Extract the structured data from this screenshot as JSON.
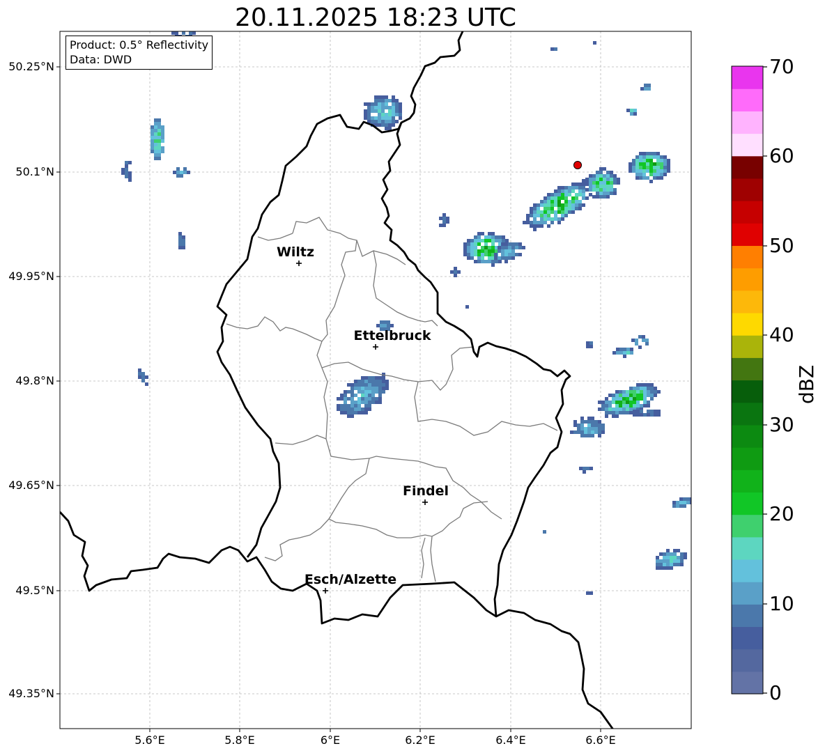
{
  "title": "20.11.2025 18:23 UTC",
  "info": {
    "product": "Product: 0.5° Reflectivity",
    "data": "Data: DWD"
  },
  "lat_ticks": [
    "50.25°N",
    "50.1°N",
    "49.95°N",
    "49.8°N",
    "49.65°N",
    "49.5°N",
    "49.35°N"
  ],
  "lon_ticks": [
    "5.6°E",
    "5.8°E",
    "6°E",
    "6.2°E",
    "6.4°E",
    "6.6°E"
  ],
  "cities": [
    {
      "name": "Wiltz"
    },
    {
      "name": "Ettelbruck"
    },
    {
      "name": "Findel"
    },
    {
      "name": "Esch/Alzette"
    }
  ],
  "colorbar": {
    "label": "dBZ",
    "ticks": [
      "0",
      "10",
      "20",
      "30",
      "40",
      "50",
      "60",
      "70"
    ],
    "colors": [
      "#6373a6",
      "#54689f",
      "#465e9e",
      "#4b78ab",
      "#5aa0c8",
      "#63c1dc",
      "#5dd6c0",
      "#3fd06e",
      "#11c626",
      "#11b21a",
      "#0f9b12",
      "#0c8a11",
      "#0a7510",
      "#075e0b",
      "#437611",
      "#aab40a",
      "#fed900",
      "#fdb80a",
      "#fe9d00",
      "#ff7f01",
      "#e00101",
      "#c60000",
      "#9f0101",
      "#780100",
      "#ffdfff",
      "#ffb3fe",
      "#ff6bfa",
      "#e935ee"
    ]
  },
  "radar_marker": {
    "color": "#e00000"
  }
}
